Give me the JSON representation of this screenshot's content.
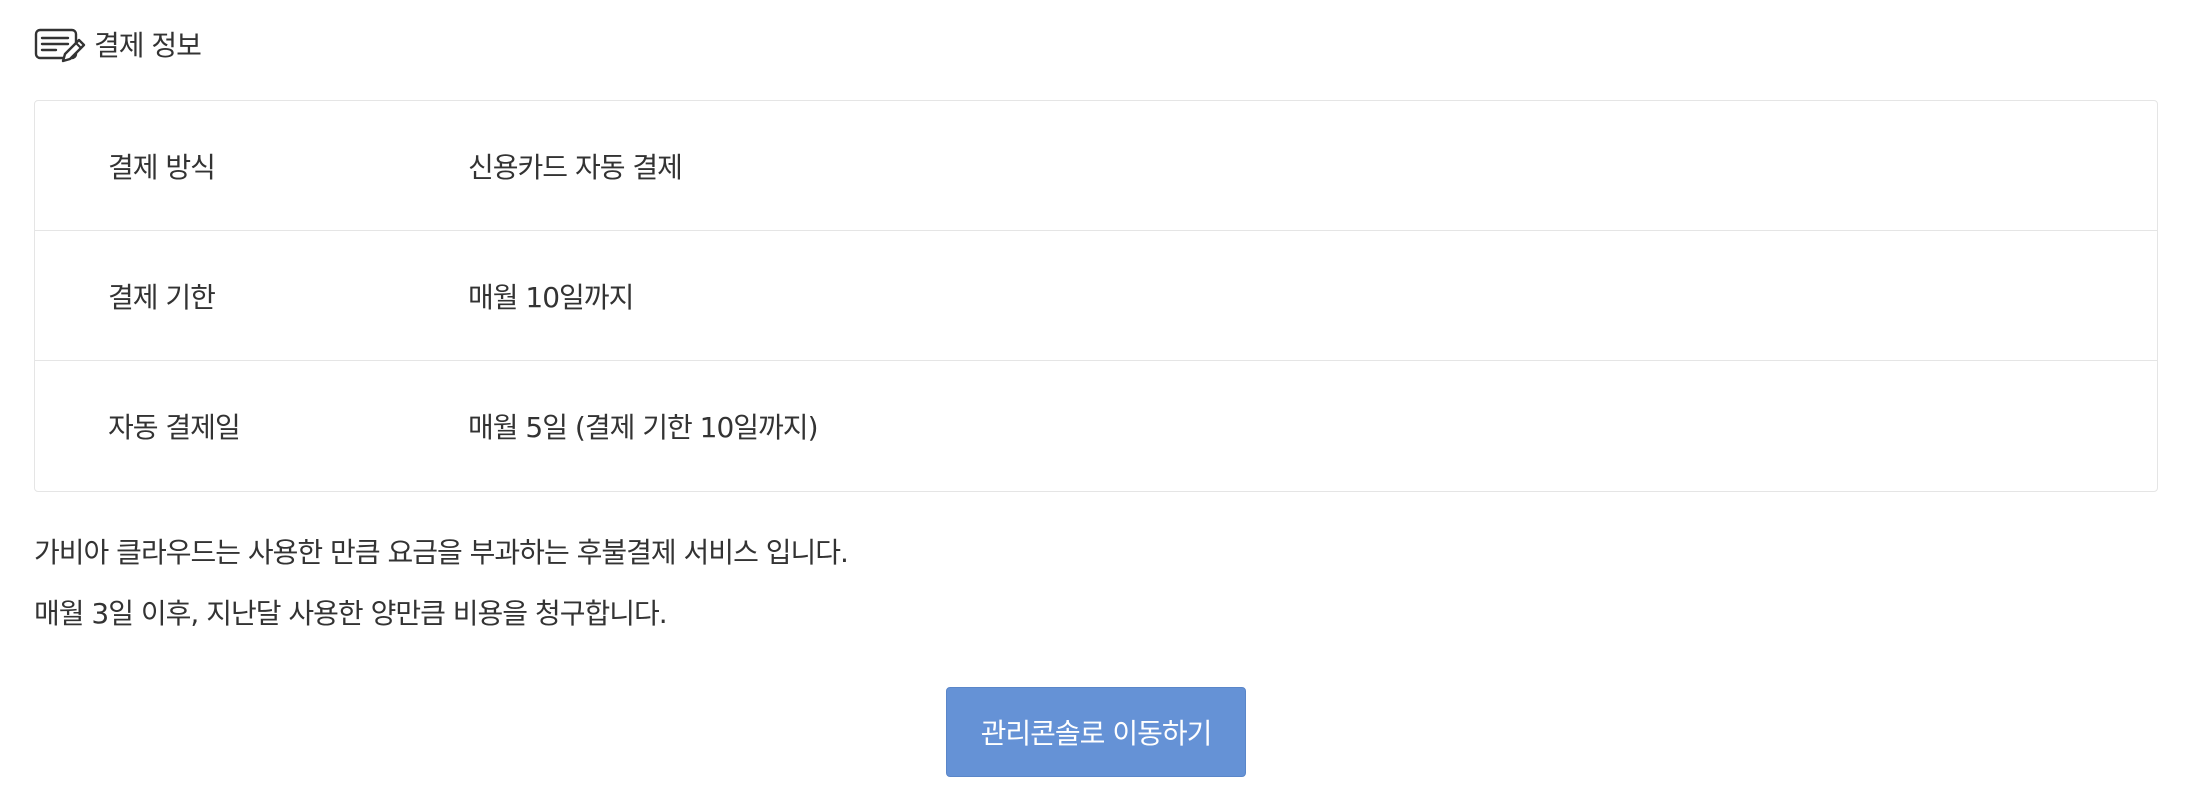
{
  "header": {
    "icon": "document-edit-icon",
    "title": "결제 정보"
  },
  "payment_info": {
    "rows": [
      {
        "label": "결제 방식",
        "value": "신용카드 자동 결제"
      },
      {
        "label": "결제 기한",
        "value": "매월 10일까지"
      },
      {
        "label": "자동 결제일",
        "value": "매월 5일 (결제 기한 10일까지)"
      }
    ]
  },
  "notice": {
    "line1": "가비아 클라우드는 사용한 만큼 요금을 부과하는 후불결제 서비스 입니다.",
    "line2": "매월 3일 이후, 지난달 사용한 양만큼 비용을 청구합니다."
  },
  "actions": {
    "console_button_label": "관리콘솔로 이동하기"
  },
  "colors": {
    "button_background": "#6592d6",
    "border": "#e5e5e5",
    "text": "#333333"
  }
}
